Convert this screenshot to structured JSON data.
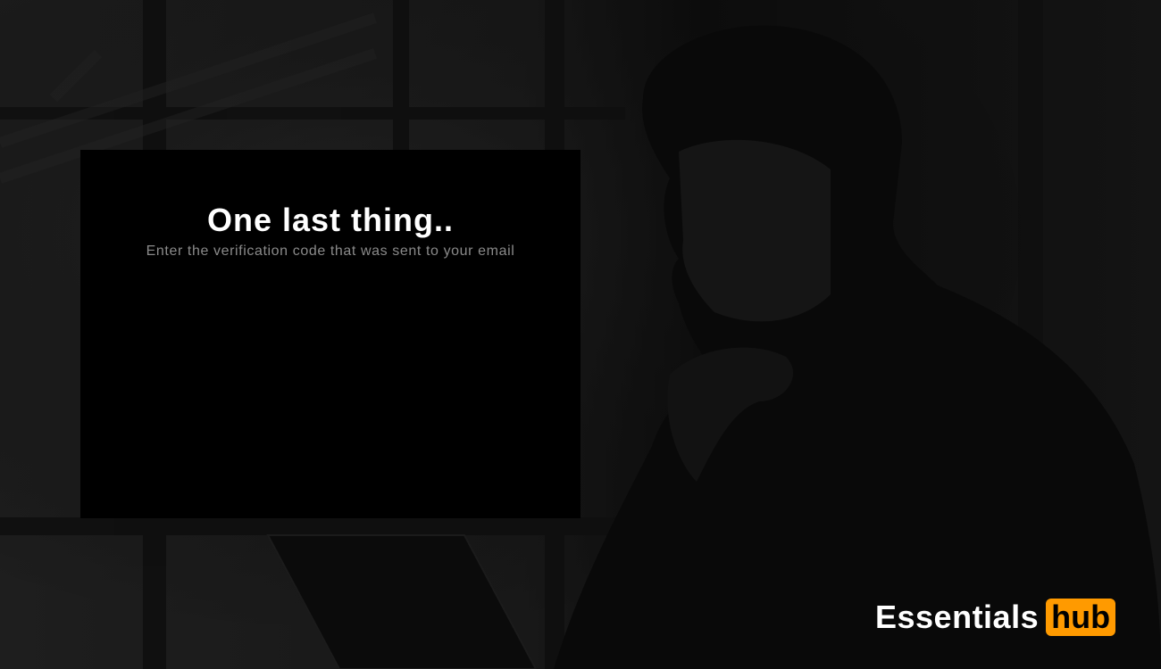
{
  "card": {
    "title": "One last thing..",
    "subtitle": "Enter the verification code that was sent to your email"
  },
  "brand": {
    "name": "Essentials",
    "badge": "hub",
    "badge_color": "#ff9a00"
  }
}
